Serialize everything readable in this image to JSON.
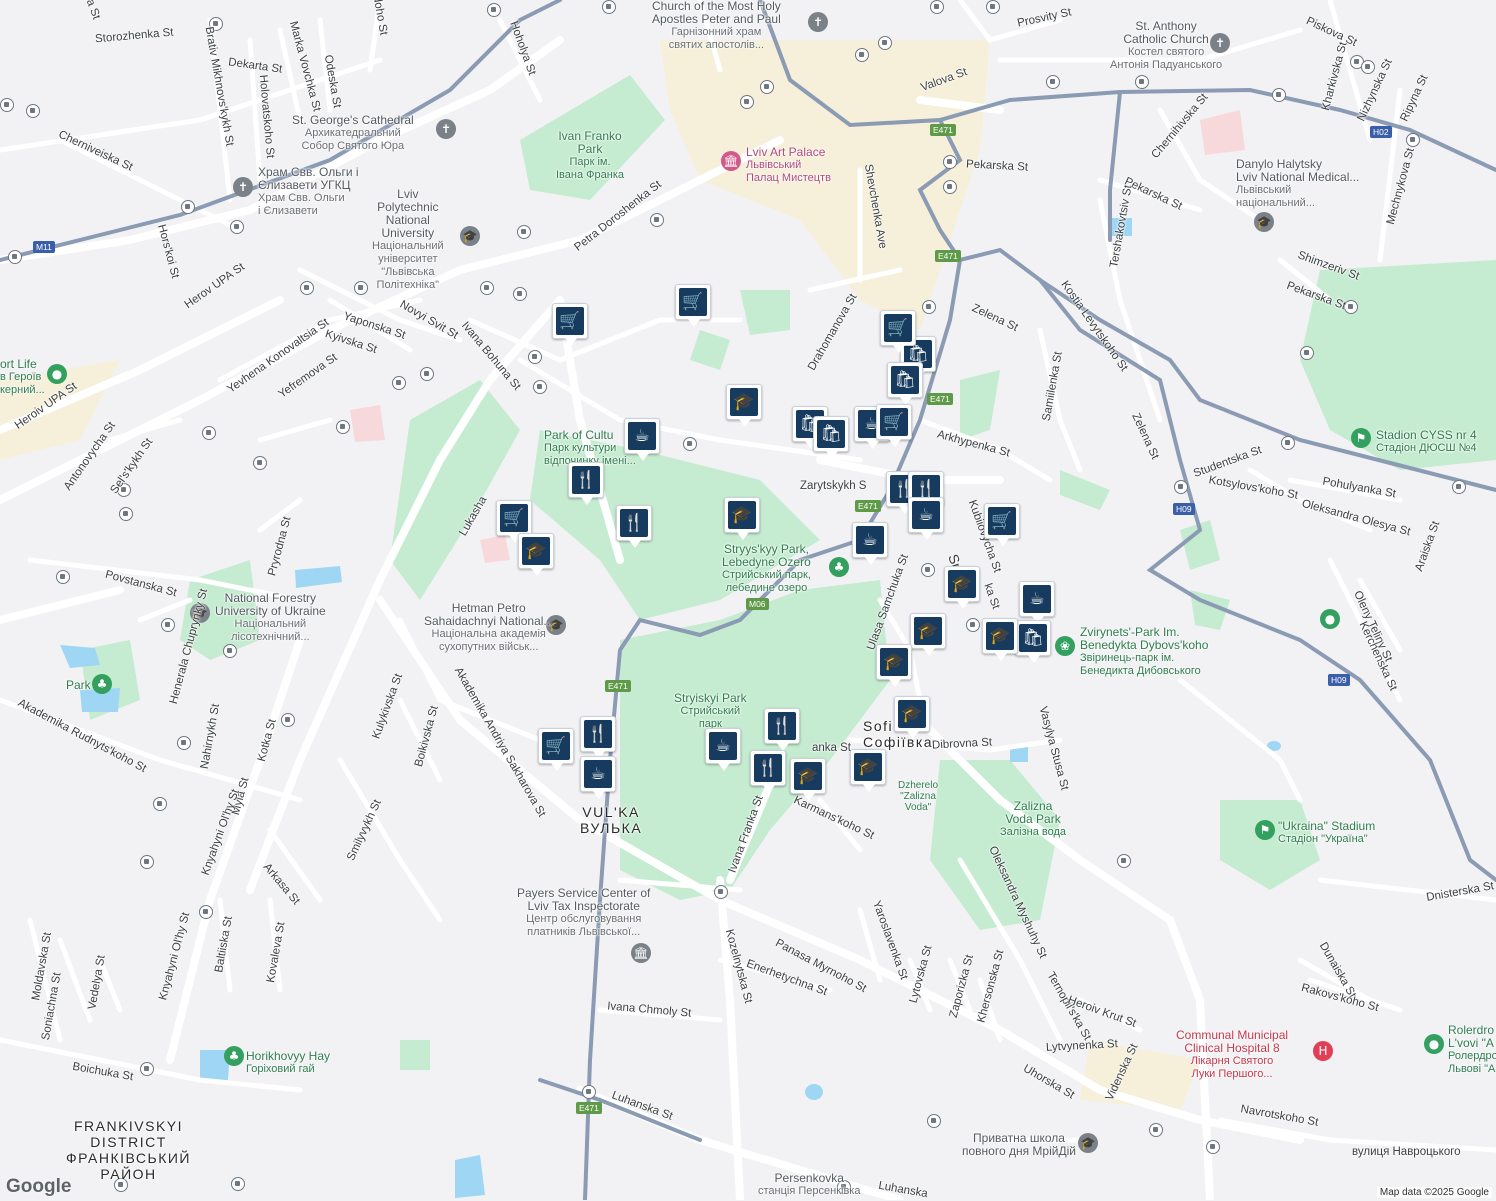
{
  "map": {
    "attribution": "Map data ©2025 Google",
    "logo": "Google",
    "colors": {
      "land": "#f2f2f4",
      "park": "#c5ebd0",
      "road": "#ffffff",
      "arterial": "#8a9bb3",
      "water": "#9fd6f3",
      "marker_fill": "#163b5e",
      "hospital": "#c5374a",
      "park_text": "#2e7d4f"
    }
  },
  "labels": {
    "church_peter_paul": "Church of the Most Holy",
    "church_peter_paul_2": "Apostles Peter and Paul",
    "church_peter_paul_uk": "Гарнізонний храм",
    "church_peter_paul_uk2": "святих апостолів...",
    "st_anthony": "St. Anthony",
    "st_anthony_2": "Catholic Church",
    "st_anthony_uk": "Костел святого",
    "st_anthony_uk2": "Антонія Падуанського",
    "st_george": "St. George's Cathedral",
    "st_george_uk": "Архикатедральний",
    "st_george_uk2": "Собор Святого Юра",
    "olga_church": "Храм Свв. Ольги і",
    "olga_church_2": "Єлизавети УГКЦ",
    "olga_church_uk": "Храм Свв. Ольги",
    "olga_church_uk2": "і Єлизавети",
    "ivan_franko_park": "Ivan Franko",
    "ivan_franko_park_2": "Park",
    "ivan_franko_park_uk": "Парк ім.",
    "ivan_franko_park_uk2": "Івана Франка",
    "art_palace": "Lviv Art Palace",
    "art_palace_uk": "Львівський",
    "art_palace_uk2": "Палац Мистецтв",
    "polytech": "Lviv",
    "polytech_2": "Polytechnic",
    "polytech_3": "National",
    "polytech_4": "University",
    "polytech_uk": "Національний",
    "polytech_uk2": "університет",
    "polytech_uk3": "\"Львівська",
    "polytech_uk4": "Політехніка\"",
    "danylo": "Danylo Halytsky",
    "danylo_2": "Lviv National Medical...",
    "danylo_uk": "Львівський",
    "danylo_uk2": "національний...",
    "sport_life": "ort Life",
    "sport_life_uk": "в Героїв",
    "sport_life_uk2": "керний...",
    "park_culture": "Park of Cultu",
    "park_culture_uk": "Парк культури",
    "park_culture_uk2": "відпочинку імені...",
    "stadion_cyss": "Stadion CYSS nr 4",
    "stadion_cyss_uk": "Стадіон ДЮСШ №4",
    "stryysky_lake": "Stryys'kyy Park,",
    "stryysky_lake_2": "Lebedyne Ozero",
    "stryysky_lake_uk": "Стрийський парк,",
    "stryysky_lake_uk2": "лебедине озеро",
    "forestry": "National Forestry",
    "forestry_2": "University of Ukraine",
    "forestry_uk": "Національний",
    "forestry_uk2": "лісотехнічний...",
    "sahaidachnyi": "Hetman Petro",
    "sahaidachnyi_2": "Sahaidachnyi National...",
    "sahaidachnyi_uk": "Національна академія",
    "sahaidachnyi_uk2": "сухопутних військ...",
    "zvirynets": "Zvirynets'-Park Im.",
    "zvirynets_2": "Benedykta Dybovs'koho",
    "zvirynets_uk": "Звіринець-парк ім.",
    "zvirynets_uk2": "Бенедикта Дибовського",
    "park_small": "Park",
    "stryiskyi_park": "Stryiskyi Park",
    "stryiskyi_park_uk": "Стрийський",
    "stryiskyi_park_uk2": "парк",
    "sofiivka": "Sofi",
    "sofiivka_uk": "Софіївка",
    "vulka": "VUL'KA",
    "vulka_uk": "ВУЛЬКА",
    "dzherelo": "Dzherelo",
    "dzherelo_2": "\"Zalizna",
    "dzherelo_3": "Voda\"",
    "zalizna_park": "Zalizna",
    "zalizna_park_2": "Voda Park",
    "zalizna_park_uk": "Залізна вода",
    "ukraina_stadium": "\"Ukraina\" Stadium",
    "ukraina_stadium_uk": "Стадіон \"Україна\"",
    "payers": "Payers Service Center of",
    "payers_2": "Lviv Tax Inspectorate",
    "payers_uk": "Центр обслуговування",
    "payers_uk2": "платників Львівської...",
    "horikhovyy": "Horikhovyy Hay",
    "horikhovyy_uk": "Горіховий гай",
    "hospital": "Communal Municipal",
    "hospital_2": "Clinical Hospital 8",
    "hospital_uk": "Лікарня Святого",
    "hospital_uk2": "Луки Першого...",
    "rolerdrom": "Rolerdro",
    "rolerdrom_2": "L'vovi \"A",
    "rolerdrom_uk": "Ролердро",
    "rolerdrom_uk2": "Львові \"А",
    "school": "Приватна школа",
    "school_2": "повного дня МрійДій",
    "persenkovka": "Persenkovka",
    "persenkovka_uk": "станція Персенківка",
    "frankivskyi": "FRANKIVSKYI",
    "frankivskyi_2": "DISTRICT",
    "frankivskyi_uk": "ФРАНКІВСЬКИЙ",
    "frankivskyi_uk2": "РАЙОН"
  },
  "streets": {
    "storozhenka": "Storozhenka St",
    "dekarta": "Dekarta St",
    "brativ": "Brativ Mikhnovs'kykh St",
    "marka": "Marka Vovchka St",
    "holovatskoho": "Holovatskoho St",
    "odeska": "Odeska St",
    "hoholya": "Hoholya St",
    "prosvity": "Prosvity St",
    "piskova": "Piskova St",
    "kharkivska": "Kharkivska St",
    "nizhynska": "Nizhynska St",
    "ripyna": "Ripyna St",
    "valova": "Valova St",
    "chernihivska": "Chernihivska St",
    "pekarska": "Pekarska St",
    "pekarska2": "Pekarska St",
    "pekarska3": "Pekarska St",
    "mechnykova": "Mechnykova St",
    "cherniveiska": "Cherniveiska St",
    "horskoi": "Hors'koi St",
    "herov_upa": "Herov UPA St",
    "heroiv_upa": "Heroiv UPA St",
    "petra_doroshenka": "Petra Doroshenka St",
    "shevchenka": "Shevchenka Ave",
    "tershakovtsiv": "Tershakovtsiv St",
    "shimzeriv": "Shimzeriv St",
    "zelena": "Zelena St",
    "zelena2": "Zelena St",
    "kostia": "Kostia Levytskoho St",
    "drahomanova": "Drahomanova St",
    "novyi_svit": "Novyi Svit St",
    "yaponska": "Yaponska St",
    "kyivska": "Kyivska St",
    "yevhena": "Yevhena Konovaltsia St",
    "yefremova": "Yefremova St",
    "ivana_bohuna": "Ivana Bohuna St",
    "samiilenka": "Samiilenka St",
    "antonovycha": "Antonovycha St",
    "selskykh": "Sel's'kykh St",
    "arkhypenka": "Arkhypenka St",
    "studentska": "Studentska St",
    "pohulyanka": "Pohulyanka St",
    "kotsylovskoho": "Kotsylovs'koho St",
    "oleksandra_olesya": "Oleksandra Olesya St",
    "zarytskykh": "Zarytskykh S",
    "kubiiovycha": "Kubiiovycha St",
    "snopkivska": "Sno",
    "snopkivska2": "ka St",
    "araiska": "Araiska St",
    "oleny_teliny": "Oleny Teliny St",
    "kerchenska": "Kerchenska St",
    "lukasha": "Lukasha",
    "pryrodna": "Pryrodna St",
    "povstanska": "Povstanska St",
    "ulasa": "Ulasa Samchuka St",
    "heneral": "Henerala Chuprynky St",
    "akademika_rudnytskoho": "Akademika Rudnyts'koho St",
    "akademika_sakharova": "Akademika Andriya Sakharova St",
    "kulykivska": "Kulykivska St",
    "boikivska": "Boikivska St",
    "nahirnykh": "Nahirnykh St",
    "kotka": "Kotka St",
    "myla": "Myla St",
    "knyahyni": "Knyahyni Ol'hy St",
    "knyahyni2": "Knyahyni Ol'hy St",
    "smilyvykh": "Smilyvykh St",
    "ivana_franka": "Ivana Franka St",
    "ivana_franka2": "anka St",
    "dibrovna": "Dibrovna St",
    "vasylya_stusa": "Vasylya Stusa St",
    "karmanskoho": "Karmans'koho St",
    "arkasa": "Arkasa St",
    "oleksandra_myshuhy": "Oleksandra Myshuhy St",
    "yaroslavenka": "Yaroslavenka St",
    "moldavska": "Moldavska St",
    "soniachna": "Soniachna St",
    "vedelya": "Vedelya St",
    "baltiiska": "Baltiiska St",
    "kovaleva": "Kovaleva St",
    "kozelnytska": "Kozelnytska St",
    "panasa_myrnoho": "Panasa Myrnoho St",
    "enerhetychna": "Enerhetychna St",
    "lytovska": "Lytovska St",
    "zaporizka": "Zaporizka St",
    "khersonska": "Khersonska St",
    "ternopilska": "Ternopil's'ka St",
    "heroiv_krut": "Heroiv Krut St",
    "dnisterska": "Dnisterska St",
    "dunaiska": "Dunaiska St",
    "rakovskoho": "Rakovs'koho St",
    "ivana_chmoly": "Ivana Chmoly St",
    "lytvynenka": "Lytvynenka St",
    "uhorska": "Uhorska St",
    "videnska": "Videnska St",
    "navrotskoho": "Navrotskoho St",
    "vulytsia_navrotskoho": "вулиця Навроцького",
    "boichuka": "Boichuka St",
    "luhanska": "Luhanska St",
    "luhanska2": "Luhanska",
    "hudoho": "udoho St",
    "na": "na St"
  },
  "shields": [
    "E471",
    "E471",
    "E471",
    "E471",
    "E471",
    "E471",
    "M06",
    "M11",
    "H09",
    "H09",
    "H02"
  ],
  "markers": [
    {
      "type": "shopping-cart",
      "glyph": "🛒"
    },
    {
      "type": "shopping-cart",
      "glyph": "🛒"
    },
    {
      "type": "shopping-cart",
      "glyph": "🛒"
    },
    {
      "type": "graduation-cap",
      "glyph": "🎓"
    },
    {
      "type": "coffee-cup",
      "glyph": "☕"
    },
    {
      "type": "fork-knife",
      "glyph": "🍴"
    },
    {
      "type": "fork-knife",
      "glyph": "🍴"
    },
    {
      "type": "shopping-cart",
      "glyph": "🛒"
    },
    {
      "type": "graduation-cap",
      "glyph": "🎓"
    },
    {
      "type": "graduation-cap",
      "glyph": "🎓"
    },
    {
      "type": "shopping-bag",
      "glyph": "🛍"
    },
    {
      "type": "shopping-bag",
      "glyph": "🛍"
    },
    {
      "type": "shopping-bag",
      "glyph": "🛍"
    },
    {
      "type": "coffee-cup",
      "glyph": "☕"
    },
    {
      "type": "shopping-bag",
      "glyph": "🛍"
    },
    {
      "type": "fork-knife",
      "glyph": "🍴"
    },
    {
      "type": "fork-knife",
      "glyph": "🍴"
    },
    {
      "type": "coffee-cup",
      "glyph": "☕"
    },
    {
      "type": "coffee-cup",
      "glyph": "☕"
    },
    {
      "type": "shopping-cart",
      "glyph": "🛒"
    },
    {
      "type": "graduation-cap",
      "glyph": "🎓"
    },
    {
      "type": "coffee-cup",
      "glyph": "☕"
    },
    {
      "type": "shopping-bag",
      "glyph": "🛍"
    },
    {
      "type": "graduation-cap",
      "glyph": "🎓"
    },
    {
      "type": "graduation-cap",
      "glyph": "🎓"
    },
    {
      "type": "graduation-cap",
      "glyph": "🎓"
    },
    {
      "type": "graduation-cap",
      "glyph": "🎓"
    },
    {
      "type": "fork-knife",
      "glyph": "🍴"
    },
    {
      "type": "coffee-cup",
      "glyph": "☕"
    },
    {
      "type": "fork-knife",
      "glyph": "🍴"
    },
    {
      "type": "graduation-cap",
      "glyph": "🎓"
    },
    {
      "type": "graduation-cap",
      "glyph": "🎓"
    },
    {
      "type": "shopping-cart",
      "glyph": "🛒"
    },
    {
      "type": "fork-knife",
      "glyph": "🍴"
    },
    {
      "type": "coffee-cup",
      "glyph": "☕"
    },
    {
      "type": "shopping-cart",
      "glyph": "🛒"
    }
  ]
}
